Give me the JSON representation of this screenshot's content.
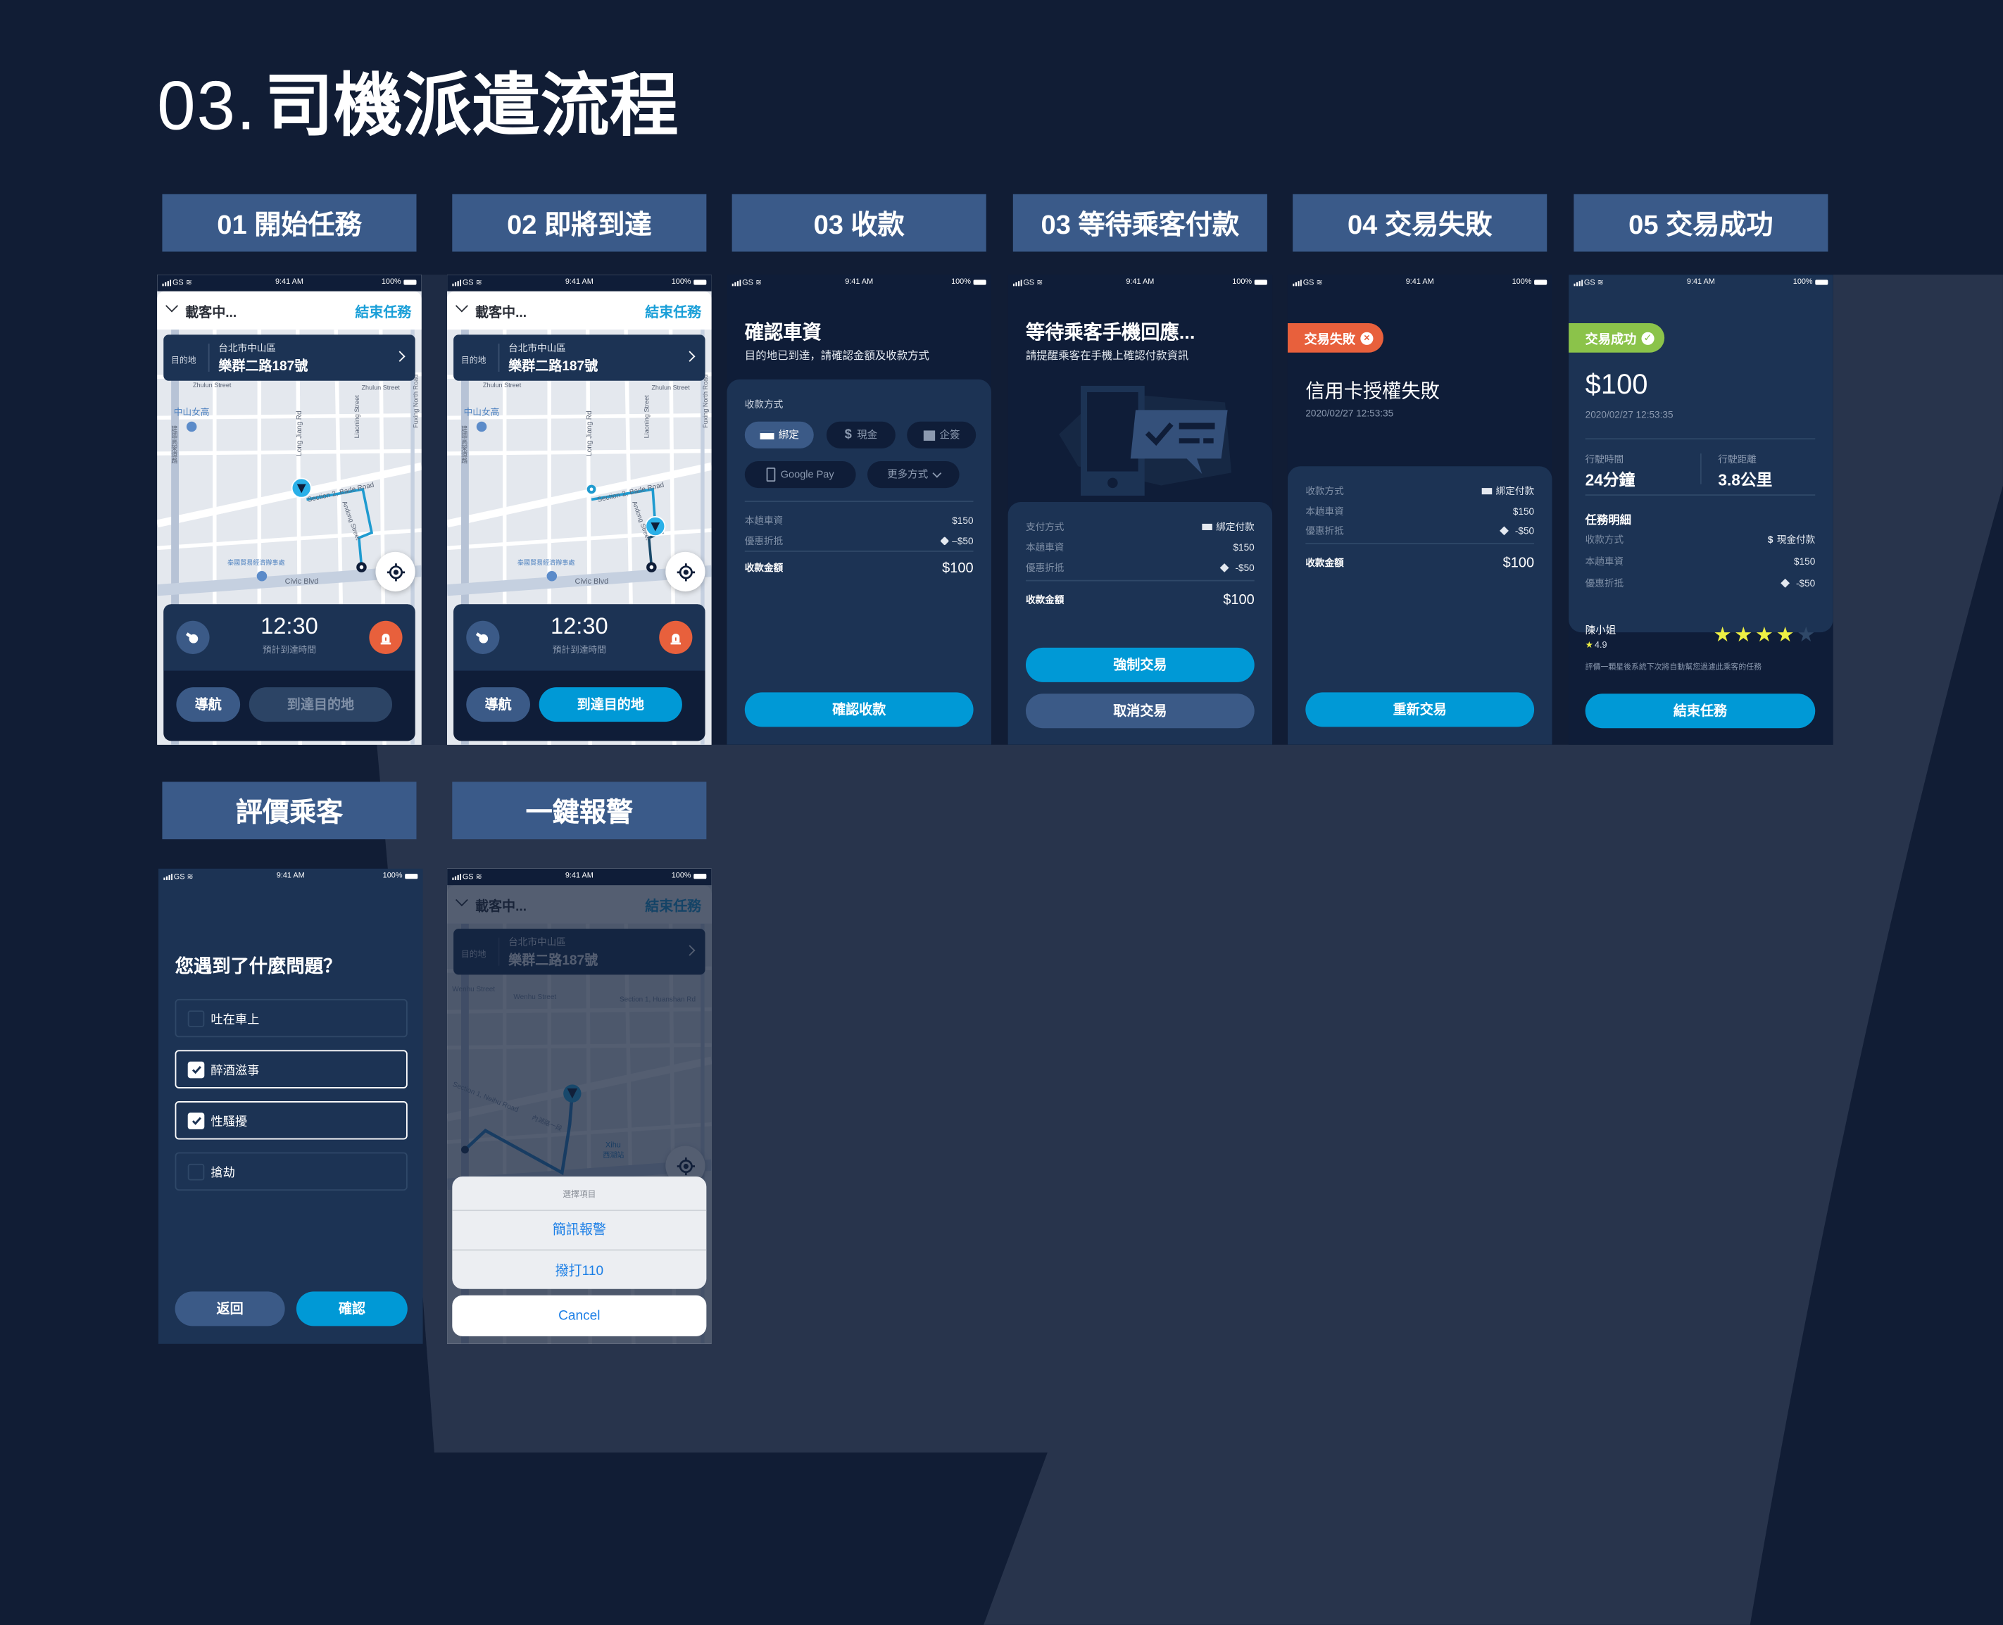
{
  "page_title": {
    "number": "03.",
    "text": "司機派遣流程"
  },
  "sections": [
    "01 開始任務",
    "02 即將到達",
    "03 收款",
    "03 等待乘客付款",
    "04 交易失敗",
    "05 交易成功",
    "評價乘客",
    "一鍵報警"
  ],
  "status_bar": {
    "carrier": "GS",
    "time": "9:41 AM",
    "battery": "100%"
  },
  "trip": {
    "status": "載客中...",
    "end_task": "結束任務",
    "dest_label": "目的地",
    "dest_district": "台北市中山區",
    "dest_address": "樂群二路187號",
    "eta": "12:30",
    "eta_label": "預計到達時間",
    "nav_button": "導航",
    "arrive_button": "到達目的地",
    "icons": {
      "left": "whistle-icon",
      "right": "alarm-siren-icon",
      "locate": "locate-icon"
    }
  },
  "map_labels": {
    "zhulun": "Zhulun Street",
    "longjiang": "Long Jiang Rd",
    "liaoning": "Liaoning Street",
    "bade": "Section 2, Bade Road",
    "andong": "Andong Street",
    "civic": "Civic Blvd",
    "fuxing": "Fuxing North Road",
    "school": "中山女高",
    "expressway": "建國高架道路",
    "office": "泰國貿易經濟辦事處"
  },
  "alert_map_labels": {
    "wenhu": "Wenhu Street",
    "huanshan": "Section 1, Huanshan Rd",
    "neihu": "Section 1, Neihu Road",
    "neihu_zh": "內湖路一段",
    "xihu": "Xihu",
    "xihu_zh": "西湖站"
  },
  "confirm": {
    "title": "確認車資",
    "subtitle": "目的地已到達，請確認金額及收款方式",
    "method_label": "收款方式",
    "methods": [
      {
        "label": "綁定",
        "icon": "credit-card-icon",
        "selected": true
      },
      {
        "label": "現金",
        "icon": "dollar-icon",
        "selected": false
      },
      {
        "label": "企簽",
        "icon": "building-icon",
        "selected": false
      },
      {
        "label": "Google Pay",
        "icon": "phone-icon",
        "selected": false
      },
      {
        "label": "更多方式",
        "icon": "chevron-down-icon",
        "selected": false
      }
    ],
    "fare_label": "本趟車資",
    "fare": "$150",
    "discount_label": "優惠折抵",
    "discount": "–$50",
    "total_label": "收款金額",
    "total": "$100",
    "button": "確認收款"
  },
  "waiting": {
    "title": "等待乘客手機回應...",
    "subtitle": "請提醒乘客在手機上確認付款資訊",
    "pay_method_label": "支付方式",
    "pay_method": "綁定付款",
    "fare_label": "本趟車資",
    "fare": "$150",
    "discount_label": "優惠折抵",
    "discount": "-$50",
    "total_label": "收款金額",
    "total": "$100",
    "force_button": "強制交易",
    "cancel_button": "取消交易"
  },
  "failed": {
    "badge": "交易失敗",
    "title": "信用卡授權失敗",
    "datetime": "2020/02/27 12:53:35",
    "method_label": "收款方式",
    "method": "綁定付款",
    "fare_label": "本趟車資",
    "fare": "$150",
    "discount_label": "優惠折抵",
    "discount": "-$50",
    "total_label": "收款金額",
    "total": "$100",
    "button": "重新交易",
    "badge_color": "#e8603c"
  },
  "success": {
    "badge": "交易成功",
    "amount": "$100",
    "datetime": "2020/02/27 12:53:35",
    "time_label": "行駛時間",
    "time": "24分鐘",
    "distance_label": "行駛距離",
    "distance": "3.8公里",
    "detail_label": "任務明細",
    "method_label": "收款方式",
    "method": "現金付款",
    "fare_label": "本趟車資",
    "fare": "$150",
    "discount_label": "優惠折抵",
    "discount": "-$50",
    "passenger": "陳小姐",
    "passenger_rating": "4.9",
    "stars_given": 4,
    "stars_max": 5,
    "note": "評價一顆星後系統下次將自動幫您過濾此乘客的任務",
    "button": "結束任務",
    "badge_color": "#8bc34a"
  },
  "rate": {
    "question": "您遇到了什麼問題？",
    "options": [
      {
        "label": "吐在車上",
        "checked": false
      },
      {
        "label": "醉酒滋事",
        "checked": true
      },
      {
        "label": "性騷擾",
        "checked": true
      },
      {
        "label": "搶劫",
        "checked": false
      }
    ],
    "back_button": "返回",
    "confirm_button": "確認"
  },
  "alert": {
    "sheet_title": "選擇項目",
    "items": [
      "簡訊報警",
      "撥打110"
    ],
    "cancel": "Cancel"
  },
  "colors": {
    "accent": "#0099d6",
    "link": "#1a9fd8",
    "navy": "#0f1d38",
    "card": "#1c3354",
    "danger": "#e8603c",
    "success": "#8bc34a",
    "star": "#eef044"
  }
}
